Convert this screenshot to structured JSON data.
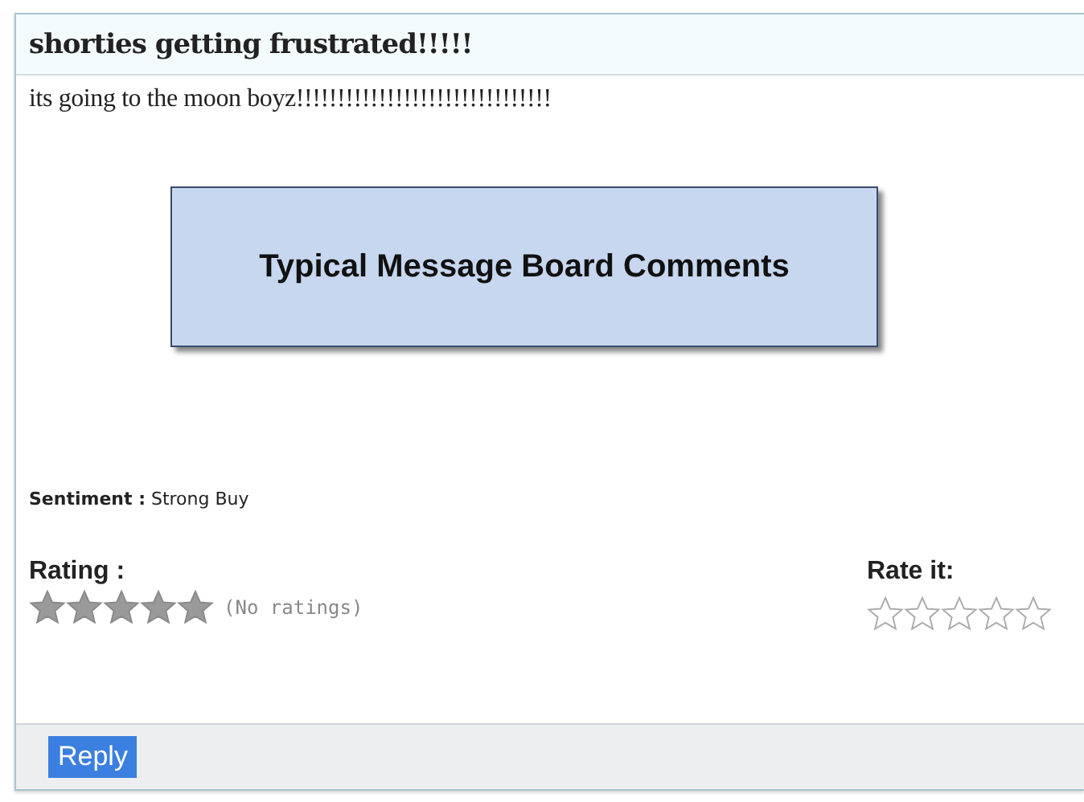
{
  "post": {
    "title": "shorties getting frustrated!!!!!",
    "body": "its going to the moon boyz!!!!!!!!!!!!!!!!!!!!!!!!!!!!!!!",
    "callout": "Typical Message Board Comments",
    "sentiment_label": "Sentiment :",
    "sentiment": "Strong Buy",
    "rating_label": "Rating :",
    "rating_note": "(No ratings)",
    "rate_label": "Rate it:",
    "reply_button": "Reply"
  }
}
